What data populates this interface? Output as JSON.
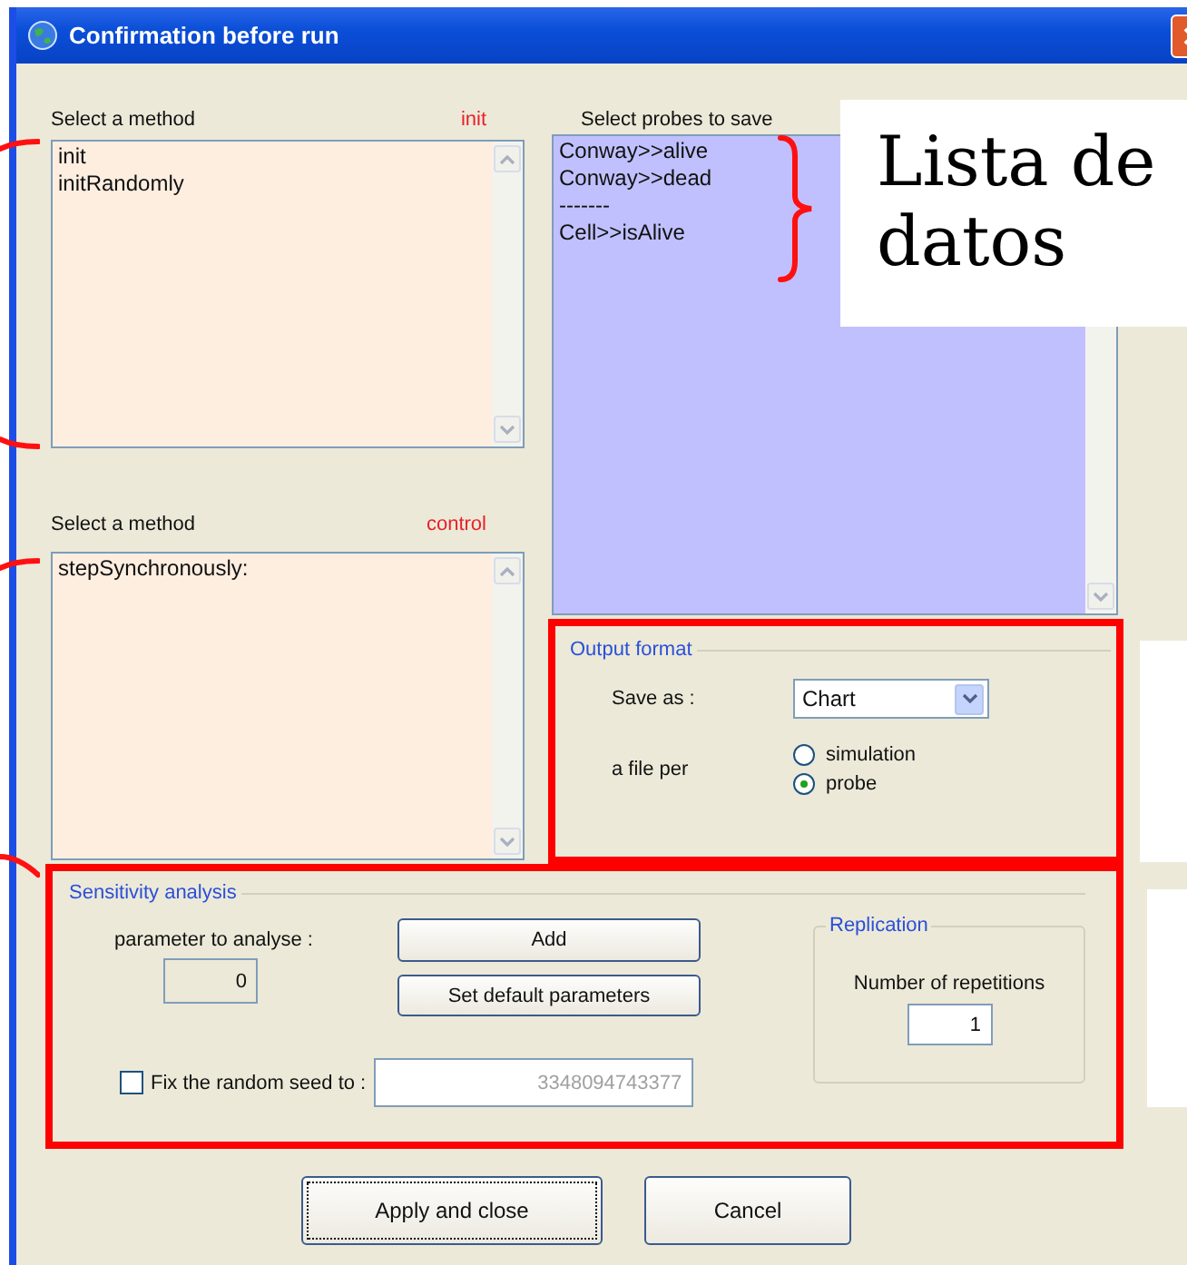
{
  "window": {
    "title": "Confirmation before run"
  },
  "init_method": {
    "label": "Select a method",
    "tag": "init",
    "items": [
      "init",
      "initRandomly"
    ]
  },
  "control_method": {
    "label": "Select a method",
    "tag": "control",
    "items": [
      "stepSynchronously:"
    ]
  },
  "probes": {
    "label": "Select probes to save",
    "items": [
      "Conway>>alive",
      "Conway>>dead",
      "-------",
      "Cell>>isAlive"
    ]
  },
  "output_format": {
    "title": "Output format",
    "save_as_label": "Save as :",
    "save_as_value": "Chart",
    "file_per_label": "a file per",
    "options": [
      {
        "label": "simulation",
        "selected": false
      },
      {
        "label": "probe",
        "selected": true
      }
    ]
  },
  "sensitivity": {
    "title": "Sensitivity analysis",
    "parameter_label": "parameter to analyse :",
    "parameter_value": "0",
    "buttons": [
      "Add",
      "Set default parameters"
    ],
    "replication": {
      "title": "Replication",
      "repetitions_label": "Number of repetitions",
      "repetitions_value": "1"
    },
    "fix_seed": {
      "label": "Fix the random seed to :",
      "checked": false,
      "value": "3348094743377"
    }
  },
  "buttons": [
    {
      "label": "Apply and close",
      "focused": true
    },
    {
      "label": "Cancel",
      "focused": false
    }
  ],
  "annotations": [
    {
      "text": "Lista de datos"
    }
  ]
}
